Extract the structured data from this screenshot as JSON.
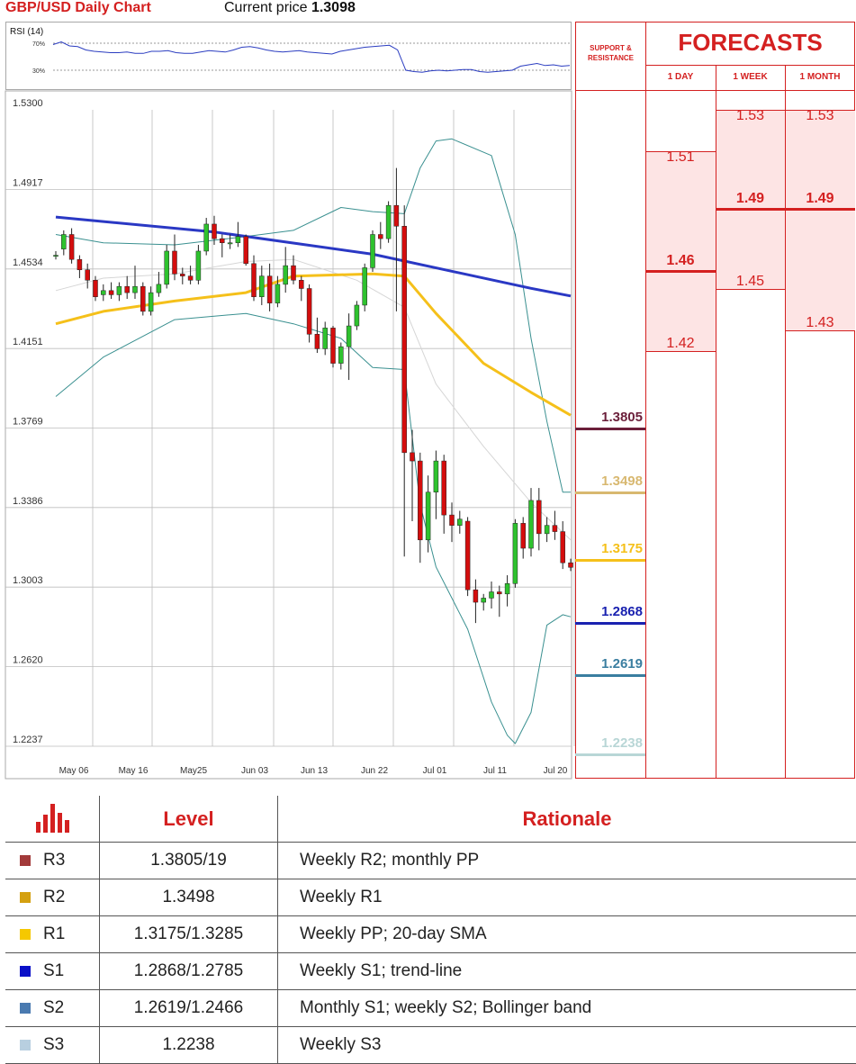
{
  "header": {
    "title": "GBP/USD Daily Chart",
    "price_label": "Current price",
    "price_value": "1.3098"
  },
  "rsi": {
    "label": "RSI (14)",
    "levels": [
      "70%",
      "30%"
    ],
    "values": [
      68,
      72,
      66,
      65,
      60,
      58,
      57,
      56,
      56,
      57,
      55,
      55,
      58,
      58,
      59,
      56,
      55,
      55,
      57,
      59,
      58,
      57,
      60,
      64,
      65,
      63,
      60,
      58,
      57,
      58,
      59,
      57,
      56,
      55,
      54,
      58,
      60,
      62,
      64,
      65,
      66,
      67,
      60,
      30,
      28,
      27,
      29,
      30,
      29,
      30,
      31,
      31,
      28,
      27,
      28,
      29,
      30,
      36,
      38,
      40,
      37,
      38,
      36,
      37
    ]
  },
  "colors": {
    "accent": "#d42020",
    "candle_up": "#2ec22e",
    "candle_down": "#d40d0d",
    "sma_blue": "#2a38c4",
    "sma_yellow": "#f5c01a",
    "bollinger": "#3a9090",
    "sma20": "#d6d6d6"
  },
  "chart_data": {
    "type": "candlestick",
    "title": "GBP/USD Daily Chart",
    "ylim": [
      1.2237,
      1.53
    ],
    "y_ticks": [
      "1.5300",
      "1.4917",
      "1.4534",
      "1.4151",
      "1.3769",
      "1.3386",
      "1.3003",
      "1.2620",
      "1.2237"
    ],
    "x_ticks": [
      "May 06",
      "May 16",
      "May25",
      "Jun 03",
      "Jun 13",
      "Jun 22",
      "Jul 01",
      "Jul 11",
      "Jul 20"
    ],
    "candles": [
      [
        1.46,
        1.462,
        1.458,
        1.46
      ],
      [
        1.463,
        1.472,
        1.46,
        1.47
      ],
      [
        1.47,
        1.473,
        1.456,
        1.458
      ],
      [
        1.458,
        1.46,
        1.449,
        1.453
      ],
      [
        1.453,
        1.456,
        1.444,
        1.448
      ],
      [
        1.448,
        1.45,
        1.438,
        1.44
      ],
      [
        1.441,
        1.446,
        1.438,
        1.443
      ],
      [
        1.443,
        1.447,
        1.439,
        1.441
      ],
      [
        1.441,
        1.447,
        1.438,
        1.445
      ],
      [
        1.445,
        1.45,
        1.439,
        1.442
      ],
      [
        1.442,
        1.455,
        1.439,
        1.445
      ],
      [
        1.445,
        1.447,
        1.431,
        1.433
      ],
      [
        1.433,
        1.445,
        1.431,
        1.442
      ],
      [
        1.442,
        1.452,
        1.44,
        1.446
      ],
      [
        1.446,
        1.465,
        1.444,
        1.462
      ],
      [
        1.462,
        1.47,
        1.448,
        1.451
      ],
      [
        1.451,
        1.454,
        1.446,
        1.45
      ],
      [
        1.45,
        1.455,
        1.446,
        1.448
      ],
      [
        1.448,
        1.465,
        1.446,
        1.462
      ],
      [
        1.462,
        1.478,
        1.46,
        1.475
      ],
      [
        1.475,
        1.479,
        1.465,
        1.468
      ],
      [
        1.468,
        1.47,
        1.459,
        1.466
      ],
      [
        1.466,
        1.47,
        1.463,
        1.466
      ],
      [
        1.466,
        1.476,
        1.464,
        1.469
      ],
      [
        1.469,
        1.47,
        1.455,
        1.456
      ],
      [
        1.456,
        1.46,
        1.438,
        1.44
      ],
      [
        1.44,
        1.455,
        1.436,
        1.45
      ],
      [
        1.45,
        1.456,
        1.433,
        1.437
      ],
      [
        1.437,
        1.45,
        1.435,
        1.446
      ],
      [
        1.446,
        1.464,
        1.442,
        1.455
      ],
      [
        1.455,
        1.46,
        1.446,
        1.448
      ],
      [
        1.448,
        1.45,
        1.438,
        1.444
      ],
      [
        1.444,
        1.446,
        1.418,
        1.422
      ],
      [
        1.422,
        1.43,
        1.413,
        1.415
      ],
      [
        1.415,
        1.428,
        1.412,
        1.425
      ],
      [
        1.425,
        1.426,
        1.406,
        1.408
      ],
      [
        1.408,
        1.418,
        1.405,
        1.416
      ],
      [
        1.416,
        1.432,
        1.4,
        1.426
      ],
      [
        1.426,
        1.438,
        1.424,
        1.436
      ],
      [
        1.436,
        1.456,
        1.433,
        1.454
      ],
      [
        1.454,
        1.472,
        1.452,
        1.47
      ],
      [
        1.47,
        1.476,
        1.463,
        1.468
      ],
      [
        1.468,
        1.486,
        1.466,
        1.484
      ],
      [
        1.484,
        1.502,
        1.433,
        1.474
      ],
      [
        1.474,
        1.484,
        1.315,
        1.365
      ],
      [
        1.365,
        1.376,
        1.332,
        1.361
      ],
      [
        1.361,
        1.365,
        1.312,
        1.323
      ],
      [
        1.323,
        1.354,
        1.317,
        1.346
      ],
      [
        1.346,
        1.366,
        1.333,
        1.361
      ],
      [
        1.361,
        1.364,
        1.326,
        1.335
      ],
      [
        1.335,
        1.341,
        1.322,
        1.33
      ],
      [
        1.33,
        1.337,
        1.326,
        1.333
      ],
      [
        1.332,
        1.334,
        1.296,
        1.299
      ],
      [
        1.299,
        1.304,
        1.283,
        1.293
      ],
      [
        1.293,
        1.297,
        1.289,
        1.295
      ],
      [
        1.295,
        1.303,
        1.29,
        1.298
      ],
      [
        1.298,
        1.301,
        1.286,
        1.297
      ],
      [
        1.297,
        1.306,
        1.291,
        1.302
      ],
      [
        1.302,
        1.333,
        1.3,
        1.331
      ],
      [
        1.331,
        1.334,
        1.314,
        1.319
      ],
      [
        1.319,
        1.348,
        1.315,
        1.342
      ],
      [
        1.342,
        1.348,
        1.318,
        1.326
      ],
      [
        1.326,
        1.334,
        1.322,
        1.33
      ],
      [
        1.33,
        1.337,
        1.323,
        1.327
      ],
      [
        1.327,
        1.332,
        1.309,
        1.312
      ],
      [
        1.312,
        1.314,
        1.308,
        1.3098
      ]
    ],
    "sma_blue": [
      [
        0,
        1.4784
      ],
      [
        20,
        1.4712
      ],
      [
        40,
        1.4605
      ],
      [
        60,
        1.4441
      ],
      [
        65,
        1.4404
      ]
    ],
    "sma_yellow": [
      [
        0,
        1.427
      ],
      [
        6,
        1.433
      ],
      [
        15,
        1.438
      ],
      [
        24,
        1.442
      ],
      [
        30,
        1.45
      ],
      [
        40,
        1.451
      ],
      [
        44,
        1.45
      ],
      [
        48,
        1.432
      ],
      [
        54,
        1.408
      ],
      [
        60,
        1.394
      ],
      [
        65,
        1.383
      ]
    ],
    "sma20": [
      [
        0,
        1.443
      ],
      [
        6,
        1.449
      ],
      [
        15,
        1.451
      ],
      [
        24,
        1.457
      ],
      [
        30,
        1.458
      ],
      [
        38,
        1.448
      ],
      [
        44,
        1.435
      ],
      [
        48,
        1.398
      ],
      [
        54,
        1.368
      ],
      [
        60,
        1.341
      ],
      [
        65,
        1.323
      ]
    ],
    "bollinger_upper": [
      [
        0,
        1.47
      ],
      [
        6,
        1.466
      ],
      [
        15,
        1.465
      ],
      [
        24,
        1.469
      ],
      [
        30,
        1.472
      ],
      [
        36,
        1.483
      ],
      [
        40,
        1.481
      ],
      [
        44,
        1.48
      ],
      [
        46,
        1.502
      ],
      [
        48,
        1.515
      ],
      [
        50,
        1.516
      ],
      [
        55,
        1.508
      ],
      [
        58,
        1.47
      ],
      [
        60,
        1.42
      ],
      [
        62,
        1.38
      ],
      [
        64,
        1.346
      ],
      [
        65,
        1.346
      ]
    ],
    "bollinger_lower": [
      [
        0,
        1.392
      ],
      [
        6,
        1.411
      ],
      [
        15,
        1.429
      ],
      [
        24,
        1.432
      ],
      [
        30,
        1.427
      ],
      [
        36,
        1.42
      ],
      [
        40,
        1.406
      ],
      [
        44,
        1.405
      ],
      [
        46,
        1.34
      ],
      [
        48,
        1.31
      ],
      [
        52,
        1.28
      ],
      [
        55,
        1.245
      ],
      [
        57,
        1.229
      ],
      [
        58,
        1.225
      ],
      [
        60,
        1.24
      ],
      [
        62,
        1.282
      ],
      [
        64,
        1.287
      ],
      [
        65,
        1.286
      ]
    ],
    "support_resistance": [
      {
        "value": "1.3805",
        "color": "#6b1f3a"
      },
      {
        "value": "1.3498",
        "color": "#d8b870"
      },
      {
        "value": "1.3175",
        "color": "#f5c01a"
      },
      {
        "value": "1.2868",
        "color": "#1a22b0"
      },
      {
        "value": "1.2619",
        "color": "#3a7ea0"
      },
      {
        "value": "1.2238",
        "color": "#b8d6d6"
      }
    ]
  },
  "sr_column": {
    "title": "SUPPORT & RESISTANCE"
  },
  "forecasts": {
    "title": "FORECASTS",
    "columns": [
      {
        "label": "1 DAY",
        "values": [
          "1.51",
          "1.46",
          "1.42"
        ],
        "key": "1.46"
      },
      {
        "label": "1 WEEK",
        "values": [
          "1.53",
          "1.49",
          "1.45"
        ],
        "key": "1.49"
      },
      {
        "label": "1 MONTH",
        "values": [
          "1.53",
          "1.49",
          "1.43"
        ],
        "key": "1.49"
      }
    ]
  },
  "levels_table": {
    "headers": [
      "Level",
      "Rationale"
    ],
    "rows": [
      {
        "code": "R3",
        "color": "#a23a3a",
        "level": "1.3805/19",
        "rationale": "Weekly R2; monthly PP"
      },
      {
        "code": "R2",
        "color": "#d4a010",
        "level": "1.3498",
        "rationale": "Weekly R1"
      },
      {
        "code": "R1",
        "color": "#f5c800",
        "level": "1.3175/1.3285",
        "rationale": "Weekly PP; 20-day SMA"
      },
      {
        "code": "S1",
        "color": "#0a10c8",
        "level": "1.2868/1.2785",
        "rationale": "Weekly S1; trend-line"
      },
      {
        "code": "S2",
        "color": "#4a7ab0",
        "level": "1.2619/1.2466",
        "rationale": "Monthly S1; weekly S2; Bollinger band"
      },
      {
        "code": "S3",
        "color": "#b8cfe0",
        "level": "1.2238",
        "rationale": "Weekly S3"
      }
    ]
  }
}
